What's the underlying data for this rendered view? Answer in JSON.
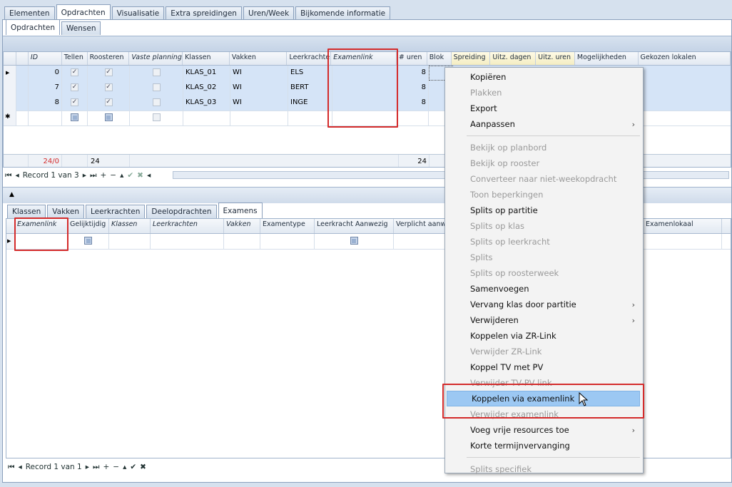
{
  "main_tabs": [
    "Elementen",
    "Opdrachten",
    "Visualisatie",
    "Extra spreidingen",
    "Uren/Week",
    "Bijkomende informatie"
  ],
  "main_tab_active": "Opdrachten",
  "sub_tabs": [
    "Opdrachten",
    "Wensen"
  ],
  "top_grid": {
    "columns": [
      "ID",
      "Tellen",
      "Roosteren",
      "Vaste planning",
      "Klassen",
      "Vakken",
      "Leerkrachten",
      "Examenlink",
      "# uren",
      "Blok",
      "Spreiding",
      "Uitz. dagen",
      "Uitz. uren",
      "Mogelijkheden",
      "Gekozen lokalen"
    ],
    "rows": [
      {
        "id": "0",
        "klassen": "KLAS_01",
        "vakken": "WI",
        "leerkrachten": "ELS",
        "uren": "8"
      },
      {
        "id": "7",
        "klassen": "KLAS_02",
        "vakken": "WI",
        "leerkrachten": "BERT",
        "uren": "8"
      },
      {
        "id": "8",
        "klassen": "KLAS_03",
        "vakken": "WI",
        "leerkrachten": "INGE",
        "uren": "8"
      }
    ],
    "new_row_marker": "✱",
    "footer": {
      "id_total": "24/0",
      "tellen_total": "24",
      "uren_total": "24"
    },
    "navigator": "Record 1 van 3"
  },
  "bottom_tabs": [
    "Klassen",
    "Vakken",
    "Leerkrachten",
    "Deelopdrachten",
    "Examens"
  ],
  "bottom_tab_active": "Examens",
  "bottom_grid": {
    "columns": [
      "Examenlink",
      "Gelijktijdig",
      "Klassen",
      "Leerkrachten",
      "Vakken",
      "Examentype",
      "Leerkracht Aanwezig",
      "Verplicht aanw",
      "Examenlokaal"
    ],
    "navigator": "Record 1 van 1"
  },
  "context_menu": [
    {
      "label": "Kopiëren",
      "enabled": true
    },
    {
      "label": "Plakken",
      "enabled": false
    },
    {
      "label": "Export",
      "enabled": true
    },
    {
      "label": "Aanpassen",
      "enabled": true,
      "submenu": true
    },
    {
      "sep": true
    },
    {
      "label": "Bekijk op planbord",
      "enabled": false
    },
    {
      "label": "Bekijk op rooster",
      "enabled": false
    },
    {
      "label": "Converteer naar niet-weekopdracht",
      "enabled": false
    },
    {
      "label": "Toon beperkingen",
      "enabled": false
    },
    {
      "label": "Splits op partitie",
      "enabled": true
    },
    {
      "label": "Splits op klas",
      "enabled": false
    },
    {
      "label": "Splits op leerkracht",
      "enabled": false
    },
    {
      "label": "Splits",
      "enabled": false
    },
    {
      "label": "Splits op roosterweek",
      "enabled": false
    },
    {
      "label": "Samenvoegen",
      "enabled": true
    },
    {
      "label": "Vervang klas door partitie",
      "enabled": true,
      "submenu": true
    },
    {
      "label": "Verwijderen",
      "enabled": true,
      "submenu": true
    },
    {
      "label": "Koppelen via ZR-Link",
      "enabled": true
    },
    {
      "label": "Verwijder ZR-Link",
      "enabled": false
    },
    {
      "label": "Koppel TV met PV",
      "enabled": true
    },
    {
      "label": "Verwijder TV-PV link",
      "enabled": false
    },
    {
      "label": "Koppelen via examenlink",
      "enabled": true,
      "highlighted": true
    },
    {
      "label": "Verwijder examenlink",
      "enabled": false
    },
    {
      "label": "Voeg vrije resources toe",
      "enabled": true,
      "submenu": true
    },
    {
      "label": "Korte termijnvervanging",
      "enabled": true
    },
    {
      "sep": true
    },
    {
      "label": "Splits specifiek",
      "enabled": false
    }
  ],
  "colors": {
    "highlight": "#9cc8f3",
    "annotation": "#d42b2b",
    "footer_red": "#d42b2b"
  },
  "icons": {
    "submenu": "chevron-right-icon",
    "row_indicator": "triangle-right-icon"
  }
}
